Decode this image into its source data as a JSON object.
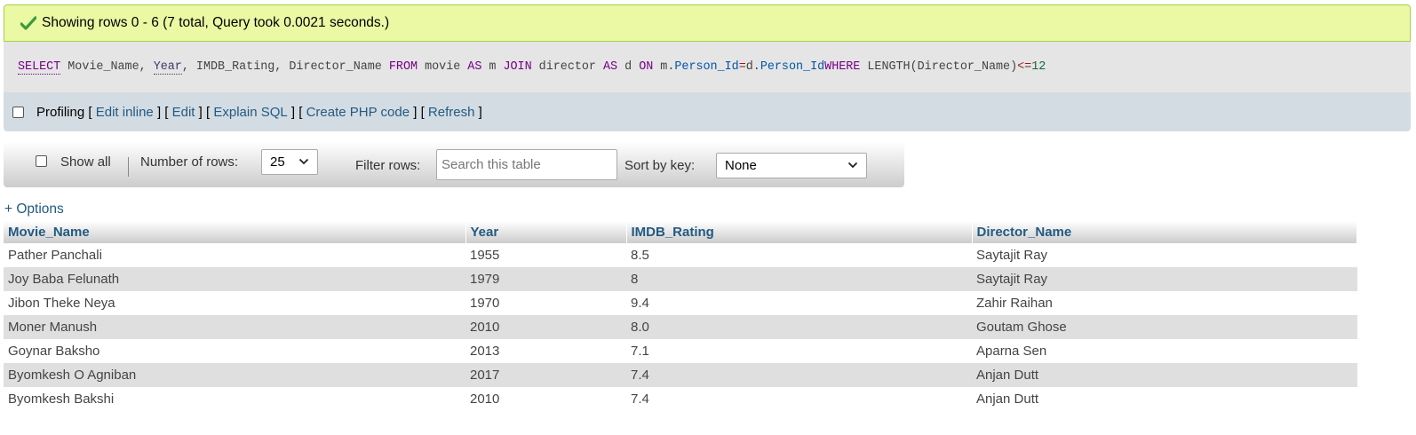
{
  "message": {
    "text": "Showing rows 0 - 6 (7 total, Query took 0.0021 seconds.)",
    "icon": "checkmark-icon",
    "color": "#ebf8a4"
  },
  "sql": {
    "select": "SELECT",
    "cols": " Movie_Name, ",
    "year": "Year",
    "rest1": ", IMDB_Rating, Director_Name ",
    "from": "FROM",
    "t1": " movie ",
    "as1": "AS",
    "a1": " m ",
    "join": "JOIN",
    "t2": " director ",
    "as2": "AS",
    "a2": " d ",
    "on": "ON",
    "m": " m.",
    "pid1": "Person_Id",
    "eq": "=",
    "d": "d.",
    "pid2": "Person_Id",
    "where": "WHERE",
    "fn": " LENGTH(Director_Name)",
    "op": "<=",
    "num": "12"
  },
  "tools": {
    "profiling": "Profiling",
    "edit_inline": "Edit inline",
    "edit": "Edit",
    "explain": "Explain SQL",
    "create_php": "Create PHP code",
    "refresh": "Refresh"
  },
  "navbar": {
    "show_all": "Show all",
    "rows_label": "Number of rows:",
    "rows_value": "25",
    "filter_label": "Filter rows:",
    "filter_placeholder": "Search this table",
    "sort_label": "Sort by key:",
    "sort_value": "None"
  },
  "options_link": "+ Options",
  "table": {
    "headers": [
      "Movie_Name",
      "Year",
      "IMDB_Rating",
      "Director_Name"
    ],
    "rows": [
      [
        "Pather Panchali",
        "1955",
        "8.5",
        "Saytajit Ray"
      ],
      [
        "Joy Baba Felunath",
        "1979",
        "8",
        "Saytajit Ray"
      ],
      [
        "Jibon Theke Neya",
        "1970",
        "9.4",
        "Zahir Raihan"
      ],
      [
        "Moner Manush",
        "2010",
        "8.0",
        "Goutam Ghose"
      ],
      [
        "Goynar Baksho",
        "2013",
        "7.1",
        "Aparna Sen"
      ],
      [
        "Byomkesh O Agniban",
        "2017",
        "7.4",
        "Anjan Dutt"
      ],
      [
        "Byomkesh Bakshi",
        "2010",
        "7.4",
        "Anjan Dutt"
      ]
    ]
  }
}
